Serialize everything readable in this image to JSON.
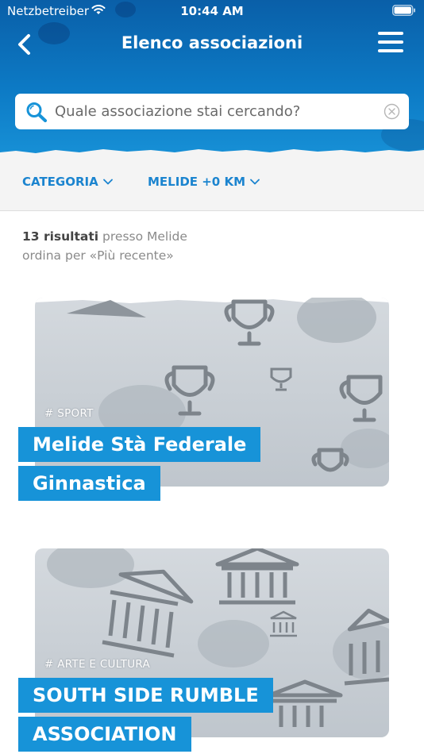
{
  "status_bar": {
    "carrier": "Netzbetreiber",
    "time": "10:44 AM"
  },
  "header": {
    "title": "Elenco associazioni"
  },
  "search": {
    "placeholder": "Quale associazione stai cercando?"
  },
  "filters": {
    "category_label": "CATEGORIA",
    "location_label": "MELIDE +0 KM"
  },
  "results": {
    "count_label": "13 risultati",
    "location_text": "presso Melide",
    "sort_text": "ordina per «Più recente»"
  },
  "cards": [
    {
      "tag": "# SPORT",
      "title_line1": "Melide Stà Federale",
      "title_line2": "Ginnastica",
      "icon": "trophy-icon"
    },
    {
      "tag": "# ARTE E CULTURA",
      "title_line1": "SOUTH SIDE RUMBLE",
      "title_line2": "ASSOCIATION",
      "icon": "museum-icon"
    }
  ],
  "colors": {
    "header_blue": "#0c79c4",
    "accent_blue": "#1793d8",
    "filter_blue": "#1b84cf"
  }
}
